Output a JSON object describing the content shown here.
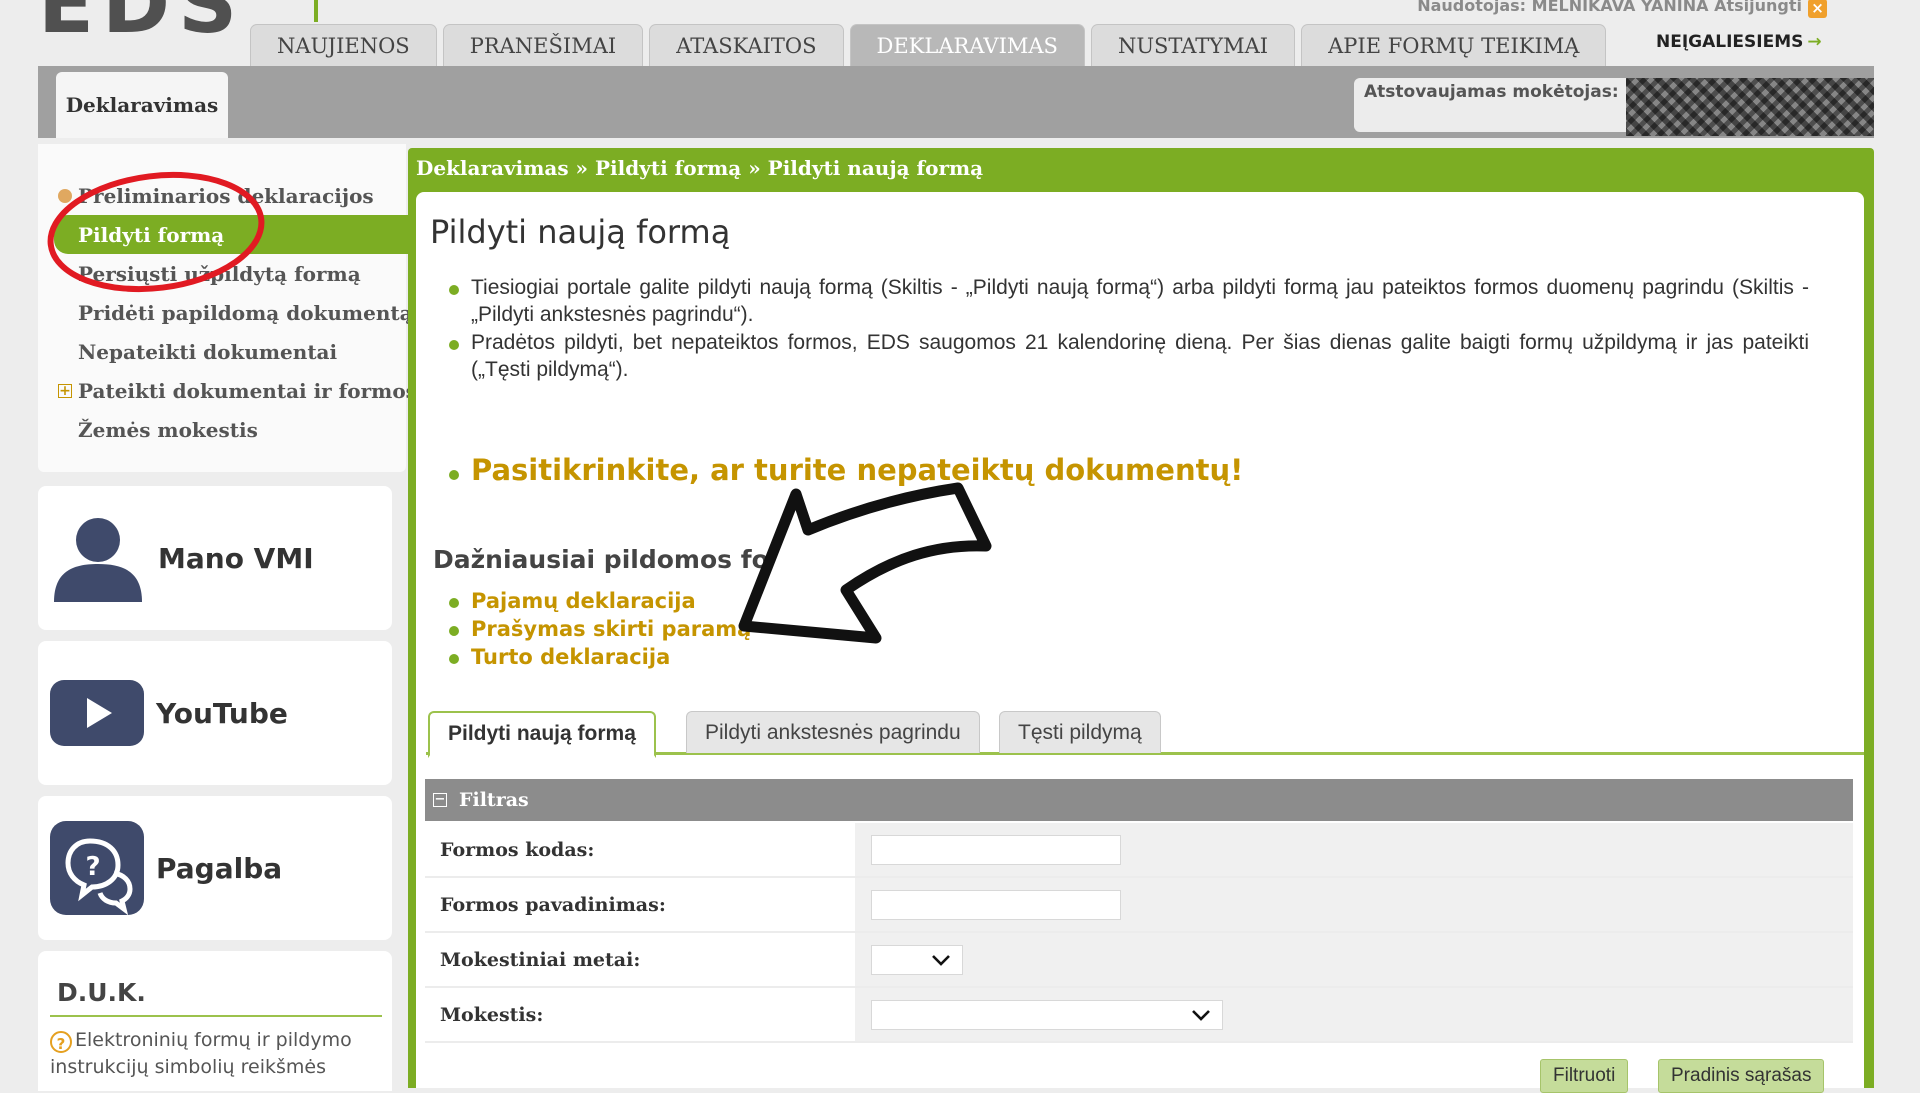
{
  "header": {
    "logo": "EDS",
    "user_line": "Naudotojas: MELNIKAVA YANINA  Atsijungti",
    "close_symbol": "×",
    "nav_tabs": [
      {
        "label": "NAUJIENOS",
        "active": false
      },
      {
        "label": "PRANEŠIMAI",
        "active": false
      },
      {
        "label": "ATASKAITOS",
        "active": false
      },
      {
        "label": "DEKLARAVIMAS",
        "active": true
      },
      {
        "label": "NUSTATYMAI",
        "active": false
      },
      {
        "label": "APIE FORMŲ TEIKIMĄ",
        "active": false
      }
    ],
    "accessibility_link": "NEĮGALIESIEMS",
    "accessibility_arrow": "→"
  },
  "subheader": {
    "tab_label": "Deklaravimas",
    "payer_label": "Atstovaujamas mokėtojas:",
    "payer_value": ""
  },
  "sidebar": {
    "menu": [
      {
        "label": "Preliminarios deklaracijos",
        "active": false,
        "icon": "dot"
      },
      {
        "label": "Pildyti formą",
        "active": true,
        "icon": ""
      },
      {
        "label": "Persiųsti užpildytą formą",
        "active": false,
        "icon": ""
      },
      {
        "label": "Pridėti papildomą dokumentą",
        "active": false,
        "icon": ""
      },
      {
        "label": "Nepateikti dokumentai",
        "active": false,
        "icon": ""
      },
      {
        "label": "Pateikti dokumentai ir formos",
        "active": false,
        "icon": "plus"
      },
      {
        "label": "Žemės mokestis",
        "active": false,
        "icon": ""
      }
    ],
    "plus_symbol": "+",
    "cards": {
      "mano_vmi": "Mano VMI",
      "youtube": "YouTube",
      "pagalba": "Pagalba"
    },
    "duk": {
      "title": "D.U.K.",
      "q_symbol": "?",
      "text": "Elektroninių formų ir pildymo instrukcijų simbolių reikšmės"
    }
  },
  "main": {
    "breadcrumb": "Deklaravimas » Pildyti formą » Pildyti naują formą",
    "title": "Pildyti naują formą",
    "info": [
      "Tiesiogiai portale galite pildyti naują formą (Skiltis - „Pildyti naują formą“) arba pildyti formą jau pateiktos formos duomenų pagrindu (Skiltis - „Pildyti ankstesnės pagrindu“).",
      "Pradėtos pildyti, bet nepateiktos formos, EDS saugomos 21 kalendorinę dieną. Per šias dienas galite baigti formų užpildymą ir jas pateikti („Tęsti pildymą“)."
    ],
    "warning": "Pasitikrinkite, ar turite nepateiktų dokumentų!",
    "frequent_title": "Dažniausiai pildomos formos",
    "frequent_links": [
      "Pajamų deklaracija",
      "Prašymas skirti paramą",
      "Turto deklaracija"
    ],
    "tabs": [
      {
        "label": "Pildyti naują formą",
        "active": true
      },
      {
        "label": "Pildyti ankstesnės pagrindu",
        "active": false
      },
      {
        "label": "Tęsti pildymą",
        "active": false
      }
    ],
    "filter": {
      "title": "Filtras",
      "collapse_symbol": "−",
      "fields": {
        "form_code": {
          "label": "Formos kodas:",
          "value": ""
        },
        "form_name": {
          "label": "Formos pavadinimas:",
          "value": ""
        },
        "tax_year": {
          "label": "Mokestiniai metai:",
          "value": ""
        },
        "tax": {
          "label": "Mokestis:",
          "value": ""
        }
      },
      "buttons": {
        "filter": "Filtruoti",
        "reset": "Pradinis sąrašas"
      }
    }
  },
  "colors": {
    "brand_green": "#7cad23",
    "accent_gold": "#c59400",
    "icon_navy": "#3f4a6b",
    "annotation_red": "#e11a22"
  }
}
